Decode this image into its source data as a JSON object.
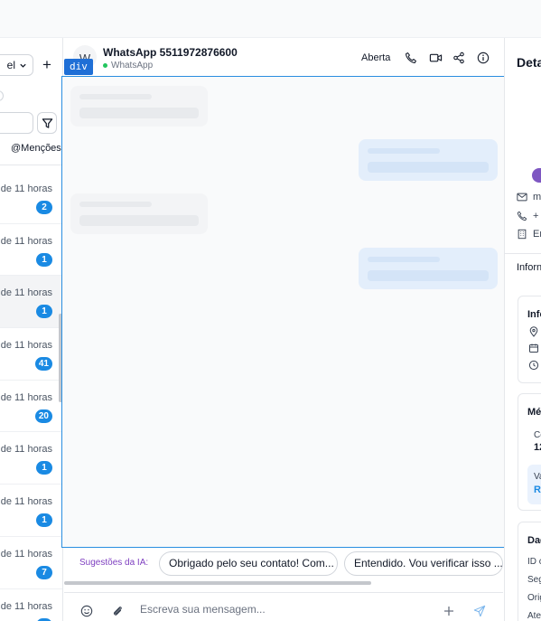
{
  "left_panel": {
    "filter_select_label": "el",
    "add_label": "+",
    "mentions_tab": "@Menções",
    "conversations": [
      {
        "time": "de 11 horas",
        "unread": "2",
        "active": false
      },
      {
        "time": "de 11 horas",
        "unread": "1",
        "active": false
      },
      {
        "time": "de 11 horas",
        "unread": "1",
        "active": true
      },
      {
        "time": "de 11 horas",
        "unread": "41",
        "active": false
      },
      {
        "time": "de 11 horas",
        "unread": "20",
        "active": false
      },
      {
        "time": "de 11 horas",
        "unread": "1",
        "active": false
      },
      {
        "time": "de 11 horas",
        "unread": "1",
        "active": false
      },
      {
        "time": "de 11 horas",
        "unread": "7",
        "active": false
      },
      {
        "time": "de 11 horas",
        "unread": "",
        "active": false
      }
    ]
  },
  "chat": {
    "avatar_initial": "W",
    "contact_name": "WhatsApp 5511972876600",
    "channel": "WhatsApp",
    "status": "Aberta",
    "inspect_tag": "div",
    "suggestions_label": "Sugestões da IA:",
    "suggestions": [
      "Obrigado pelo seu contato! Com...",
      "Entendido. Vou verificar isso ..."
    ],
    "composer_placeholder": "Escreva sua mensagem...",
    "icons": {
      "call": "phone-icon",
      "video": "video-icon",
      "share": "share-icon",
      "info": "info-icon",
      "emoji": "emoji-icon",
      "attach": "paperclip-icon",
      "add": "plus-icon",
      "send": "send-icon"
    }
  },
  "right_panel": {
    "title": "Deta",
    "email_fragment": "m",
    "phone_fragment": "+",
    "company_fragment": "Er",
    "tab_label": "Inforn",
    "info_card_title": "Info",
    "metrics_card_title": "Mét",
    "metric_label": "Co",
    "metric_value": "12",
    "value_label": "Va",
    "value_amount": "R$",
    "data_card_title": "Dad",
    "data_rows": [
      "ID c",
      "Seg",
      "Orig",
      "Aten"
    ]
  },
  "colors": {
    "accent_blue": "#1a8ae3",
    "purple": "#7e3fc0",
    "online_green": "#22c55e",
    "selection_outline": "#2a8ee0"
  }
}
